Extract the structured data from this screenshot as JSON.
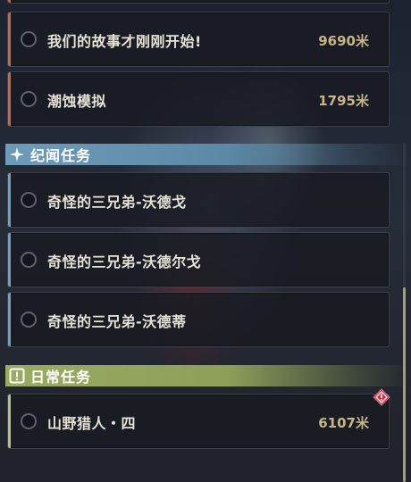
{
  "colors": {
    "top_accent": "#d0643a",
    "story_accent": "#6fa0bf",
    "daily_accent": "#b5c27a",
    "story_header": "#6d9bb8",
    "daily_header": "#8e9f5a",
    "distance_text": "#c7b489",
    "alert": "#c8344a"
  },
  "top_quests": [
    {
      "title": "我们的故事才刚刚开始!",
      "distance": "9690米"
    },
    {
      "title": "潮蚀模拟",
      "distance": "1795米"
    }
  ],
  "story_section": {
    "header": "纪闻任务",
    "icon": "four-point-star-icon",
    "quests": [
      {
        "title": "奇怪的三兄弟-沃德戈"
      },
      {
        "title": "奇怪的三兄弟-沃德尔戈"
      },
      {
        "title": "奇怪的三兄弟-沃德蒂"
      }
    ]
  },
  "daily_section": {
    "header": "日常任务",
    "icon": "exclamation-box-icon",
    "quests": [
      {
        "title": "山野猎人・四",
        "distance": "6107米",
        "alert_icon": "warning-diamond-icon"
      }
    ]
  }
}
